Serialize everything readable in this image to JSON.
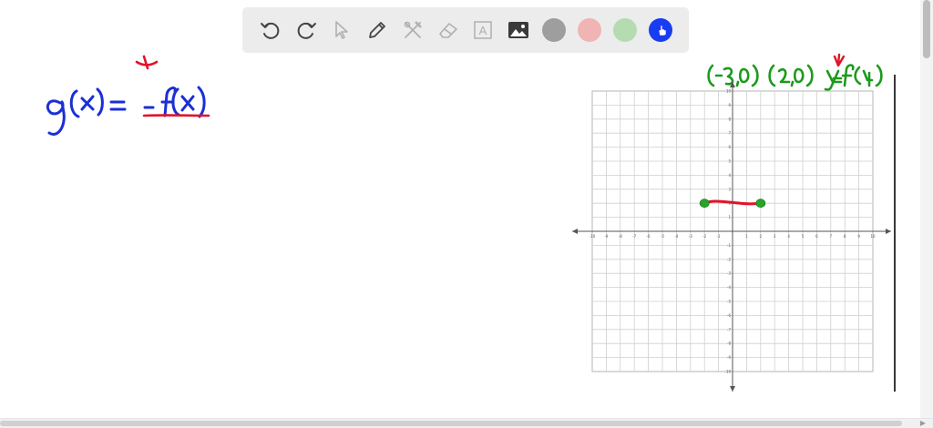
{
  "toolbar": {
    "tools": [
      {
        "name": "undo-icon",
        "label": "undo"
      },
      {
        "name": "redo-icon",
        "label": "redo"
      },
      {
        "name": "select-icon",
        "label": "select"
      },
      {
        "name": "pen-icon",
        "label": "pen"
      },
      {
        "name": "tools-icon",
        "label": "tools"
      },
      {
        "name": "eraser-icon",
        "label": "eraser"
      },
      {
        "name": "text-icon",
        "label": "text"
      },
      {
        "name": "image-icon",
        "label": "image"
      }
    ],
    "text_tool_glyph": "A",
    "colors": [
      {
        "name": "gray",
        "hex": "#9e9e9e"
      },
      {
        "name": "red",
        "hex": "#f0b4b4"
      },
      {
        "name": "green",
        "hex": "#b4dcb0"
      },
      {
        "name": "blue",
        "hex": "#1a3cf0"
      }
    ]
  },
  "board": {
    "blue_ink": "#1a2fd6",
    "red_ink": "#e0142a",
    "green_ink": "#1d9a1d",
    "point_color": "#28a428",
    "grid_range": [
      -10,
      10
    ],
    "x_ticks": [
      "-10",
      "-9",
      "-8",
      "-7",
      "-6",
      "-5",
      "-4",
      "-3",
      "-2",
      "-1",
      "1",
      "2",
      "3",
      "4",
      "5",
      "6",
      "7",
      "8",
      "9",
      "10"
    ],
    "y_ticks": [
      "10",
      "9",
      "8",
      "7",
      "6",
      "5",
      "4",
      "3",
      "2",
      "1",
      "-1",
      "-2",
      "-3",
      "-4",
      "-5",
      "-6",
      "-7",
      "-8",
      "-9",
      "-10"
    ],
    "points": [
      {
        "label": "(-2,2)",
        "x": -2,
        "y": 2
      },
      {
        "label": "(2,2)",
        "x": 2,
        "y": 2
      }
    ]
  }
}
